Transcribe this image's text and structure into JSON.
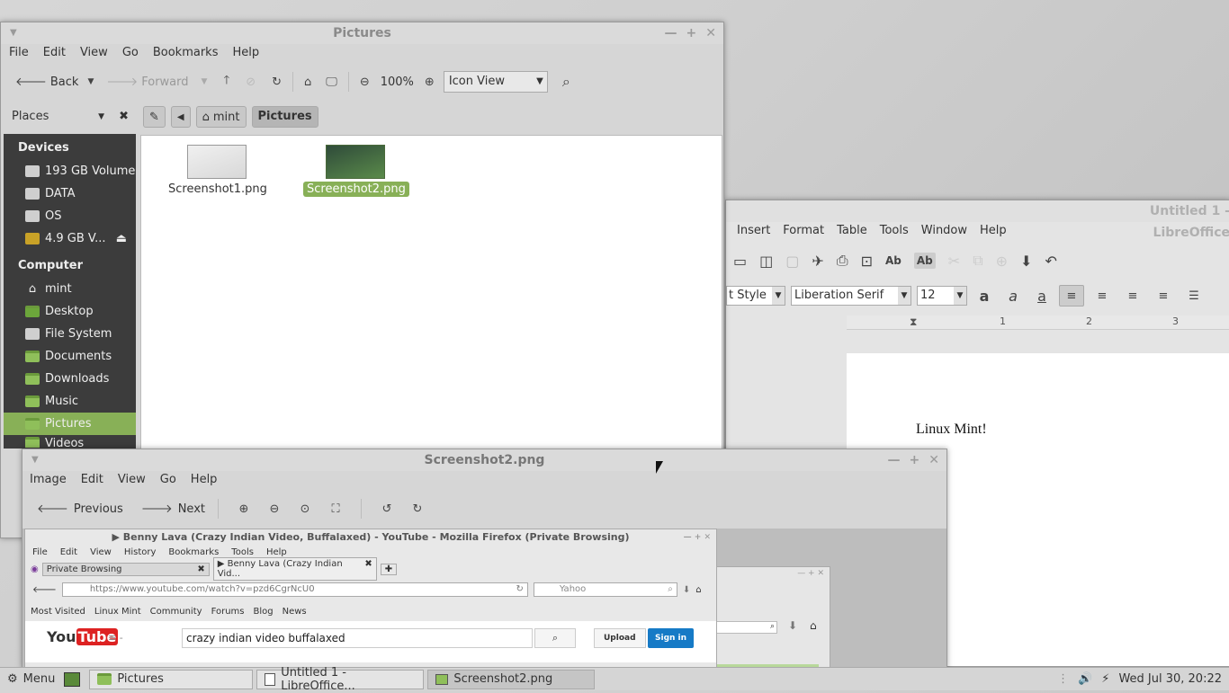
{
  "files": {
    "title": "Pictures",
    "menu": [
      "File",
      "Edit",
      "View",
      "Go",
      "Bookmarks",
      "Help"
    ],
    "toolbar": {
      "back": "Back",
      "forward": "Forward",
      "zoom": "100%",
      "view": "Icon View"
    },
    "places_label": "Places",
    "breadcrumb": [
      "mint",
      "Pictures"
    ],
    "sidebar": {
      "devices_heading": "Devices",
      "devices": [
        "193 GB Volume",
        "DATA",
        "OS",
        "4.9 GB V..."
      ],
      "computer_heading": "Computer",
      "computer": [
        "mint",
        "Desktop",
        "File System",
        "Documents",
        "Downloads",
        "Music",
        "Pictures",
        "Videos"
      ]
    },
    "items": [
      "Screenshot1.png",
      "Screenshot2.png"
    ]
  },
  "writer": {
    "title": "Untitled 1 - LibreOffice",
    "menu": [
      "Insert",
      "Format",
      "Table",
      "Tools",
      "Window",
      "Help"
    ],
    "style": "t Style",
    "font": "Liberation Serif",
    "size": "12",
    "ruler": [
      "1",
      "2",
      "3"
    ],
    "text": "Linux Mint!"
  },
  "viewer": {
    "title": "Screenshot2.png",
    "menu": [
      "Image",
      "Edit",
      "View",
      "Go",
      "Help"
    ],
    "prev": "Previous",
    "next": "Next"
  },
  "firefox": {
    "title": "▶ Benny Lava (Crazy Indian Video, Buffalaxed) - YouTube - Mozilla Firefox (Private Browsing)",
    "menu": [
      "File",
      "Edit",
      "View",
      "History",
      "Bookmarks",
      "Tools",
      "Help"
    ],
    "tab1": "Private Browsing",
    "tab2": "▶ Benny Lava (Crazy Indian Vid...",
    "url": "https://www.youtube.com/watch?v=pzd6CgrNcU0",
    "search_placeholder": "Yahoo",
    "bookmarks": [
      "Most Visited",
      "Linux Mint",
      "Community",
      "Forums",
      "Blog",
      "News"
    ],
    "yt_search": "crazy indian video buffalaxed",
    "upload": "Upload",
    "signin": "Sign in"
  },
  "taskbar": {
    "menu": "Menu",
    "tasks": [
      "Pictures",
      "Untitled 1 - LibreOffice...",
      "Screenshot2.png"
    ],
    "clock": "Wed Jul 30, 20:22"
  },
  "colors": {
    "accent": "#88b057",
    "sidebar": "#3c3c3c"
  }
}
